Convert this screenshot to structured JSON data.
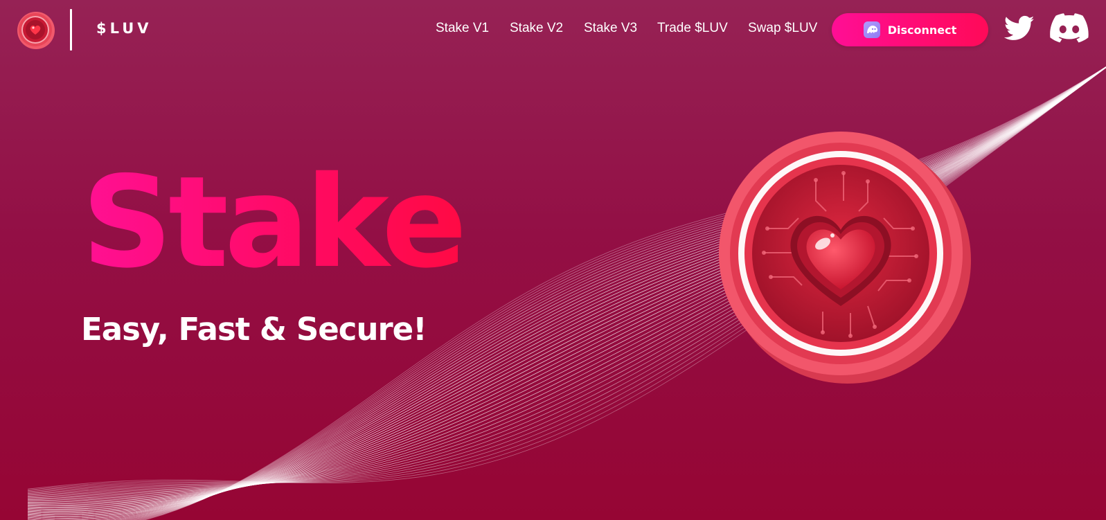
{
  "header": {
    "brand": "$LUV",
    "nav": [
      {
        "label": "Stake V1"
      },
      {
        "label": "Stake V2"
      },
      {
        "label": "Stake V3"
      },
      {
        "label": "Trade $LUV"
      },
      {
        "label": "Swap $LUV"
      }
    ],
    "wallet_button": {
      "label": "Disconnect",
      "icon": "phantom-wallet-icon"
    },
    "social": [
      {
        "icon": "twitter-icon"
      },
      {
        "icon": "discord-icon"
      }
    ]
  },
  "hero": {
    "title": "Stake",
    "subtitle": "Easy, Fast & Secure!",
    "image": "luv-heart-coin"
  },
  "colors": {
    "background_top": "#962255",
    "background_bottom": "#960534",
    "accent_pink": "#ff1093",
    "accent_red": "#ff0a58",
    "coin_red": "#f24a60",
    "text": "#ffffff"
  }
}
